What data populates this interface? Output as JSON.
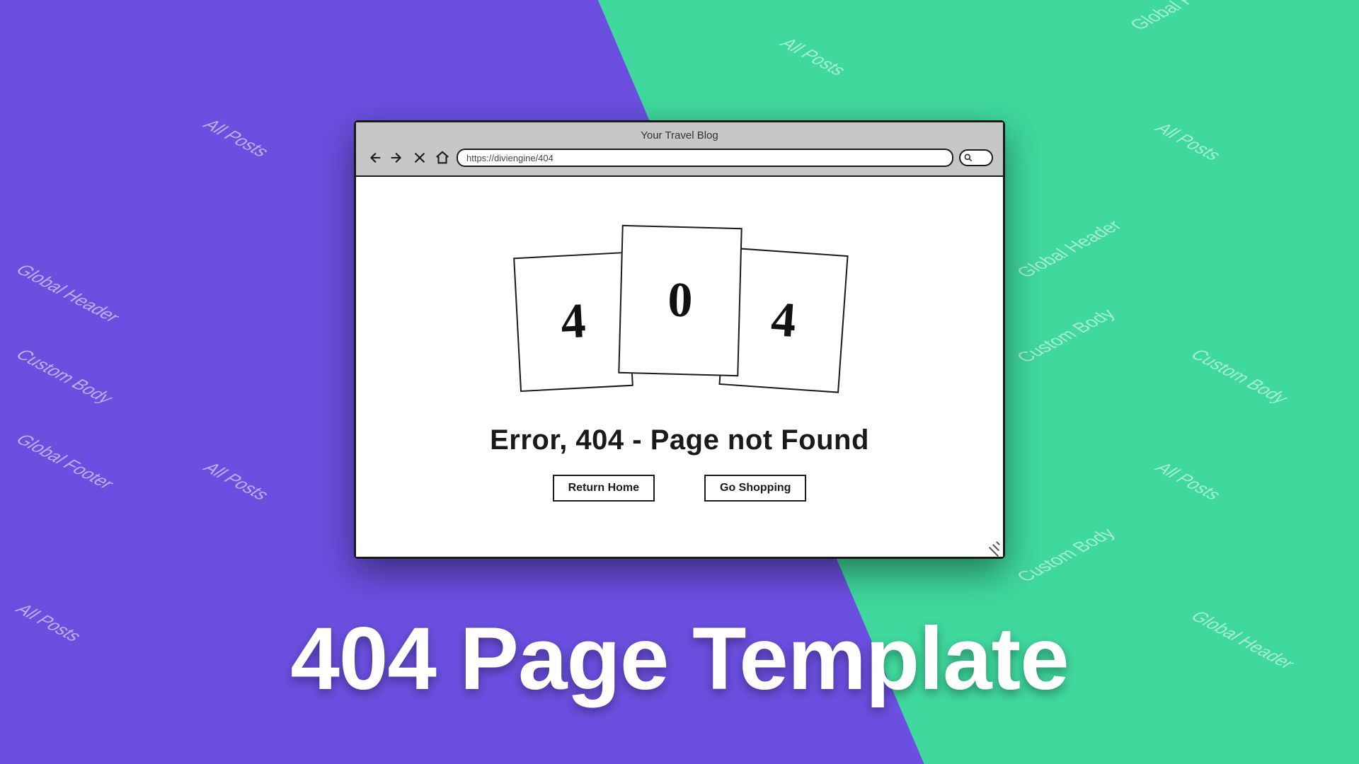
{
  "background": {
    "left_color": "#6b4fe0",
    "right_color": "#3fd89d",
    "tile_labels": [
      "All Posts",
      "Global Header",
      "Custom Body",
      "Global Footer"
    ]
  },
  "browser": {
    "title": "Your Travel Blog",
    "url": "https://diviengine/404",
    "nav": {
      "back": "back-arrow",
      "forward": "forward-arrow",
      "stop": "x-stop",
      "home": "home",
      "search": "magnify"
    }
  },
  "page": {
    "digits": [
      "4",
      "0",
      "4"
    ],
    "error_text": "Error, 404 - Page not Found",
    "buttons": {
      "return_home": "Return Home",
      "go_shopping": "Go Shopping"
    }
  },
  "headline": "404 Page Template"
}
